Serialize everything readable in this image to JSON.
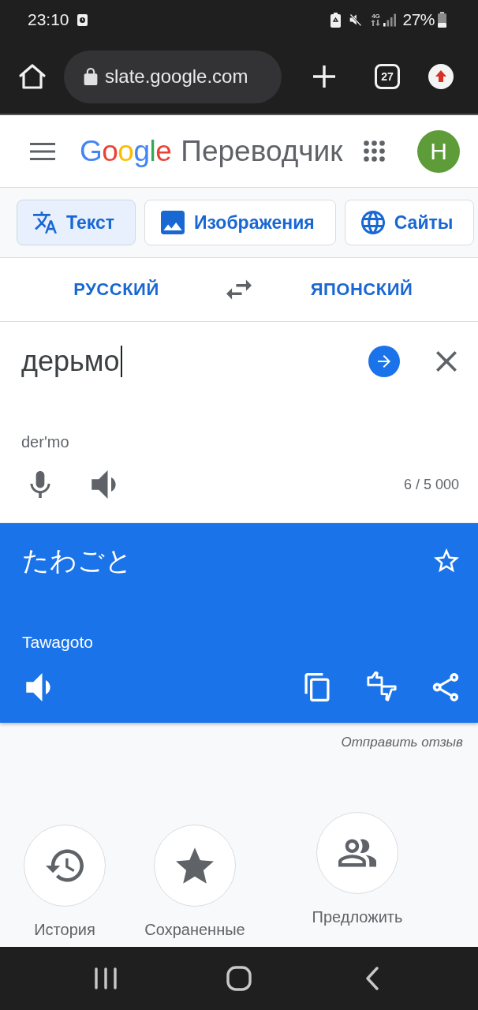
{
  "status_bar": {
    "time": "23:10",
    "network": "4G",
    "battery": "27%"
  },
  "browser": {
    "url": "slate.google.com",
    "tab_count": "27"
  },
  "header": {
    "logo": "Google",
    "title": "Переводчик",
    "avatar": "H"
  },
  "modes": [
    {
      "label": "Текст",
      "kind": "text",
      "selected": true
    },
    {
      "label": "Изображения",
      "kind": "images",
      "selected": false
    },
    {
      "label": "Сайты",
      "kind": "sites",
      "selected": false
    }
  ],
  "languages": {
    "source": "РУССКИЙ",
    "target": "ЯПОНСКИЙ"
  },
  "input": {
    "value": "дерьмо",
    "transliteration": "der'mo",
    "char_count": "6 / 5 000"
  },
  "output": {
    "text": "たわごと",
    "transliteration": "Tawagoto",
    "saved": false
  },
  "feedback_link": "Отправить отзыв",
  "shortcuts": [
    {
      "label": "История",
      "kind": "history"
    },
    {
      "label": "Сохраненные",
      "kind": "saved"
    },
    {
      "label": "Предложить",
      "kind": "suggest"
    }
  ]
}
